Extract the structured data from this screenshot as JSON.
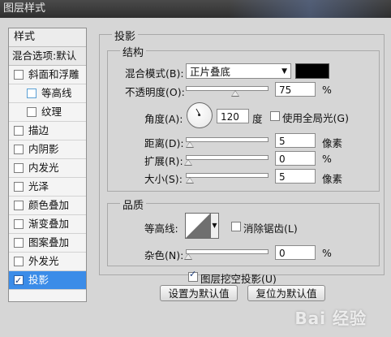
{
  "window": {
    "title": "图层样式"
  },
  "sidebar": {
    "header": "样式",
    "blend_options": "混合选项:默认",
    "items": [
      {
        "label": "斜面和浮雕",
        "checked": false,
        "sub": false
      },
      {
        "label": "等高线",
        "checked": false,
        "sub": true
      },
      {
        "label": "纹理",
        "checked": false,
        "sub": true
      },
      {
        "label": "描边",
        "checked": false,
        "sub": false
      },
      {
        "label": "内阴影",
        "checked": false,
        "sub": false
      },
      {
        "label": "内发光",
        "checked": false,
        "sub": false
      },
      {
        "label": "光泽",
        "checked": false,
        "sub": false
      },
      {
        "label": "颜色叠加",
        "checked": false,
        "sub": false
      },
      {
        "label": "渐变叠加",
        "checked": false,
        "sub": false
      },
      {
        "label": "图案叠加",
        "checked": false,
        "sub": false
      },
      {
        "label": "外发光",
        "checked": false,
        "sub": false
      },
      {
        "label": "投影",
        "checked": true,
        "sub": false
      }
    ]
  },
  "panel": {
    "title": "投影",
    "structure": {
      "title": "结构",
      "blend_mode_label": "混合模式(B):",
      "blend_mode_value": "正片叠底",
      "shadow_color": "#000000",
      "opacity_label": "不透明度(O):",
      "opacity_value": "75",
      "opacity_unit": "%",
      "angle_label": "角度(A):",
      "angle_value": "120",
      "angle_unit": "度",
      "global_light_label": "使用全局光(G)",
      "distance_label": "距离(D):",
      "distance_value": "5",
      "distance_unit": "像素",
      "spread_label": "扩展(R):",
      "spread_value": "0",
      "spread_unit": "%",
      "size_label": "大小(S):",
      "size_value": "5",
      "size_unit": "像素"
    },
    "quality": {
      "title": "品质",
      "contour_label": "等高线:",
      "antialias_label": "消除锯齿(L)",
      "noise_label": "杂色(N):",
      "noise_value": "0",
      "noise_unit": "%"
    },
    "knockout_label": "图层挖空投影(U)",
    "make_default_button": "设置为默认值",
    "reset_default_button": "复位为默认值"
  },
  "watermark": "Bai 经验"
}
